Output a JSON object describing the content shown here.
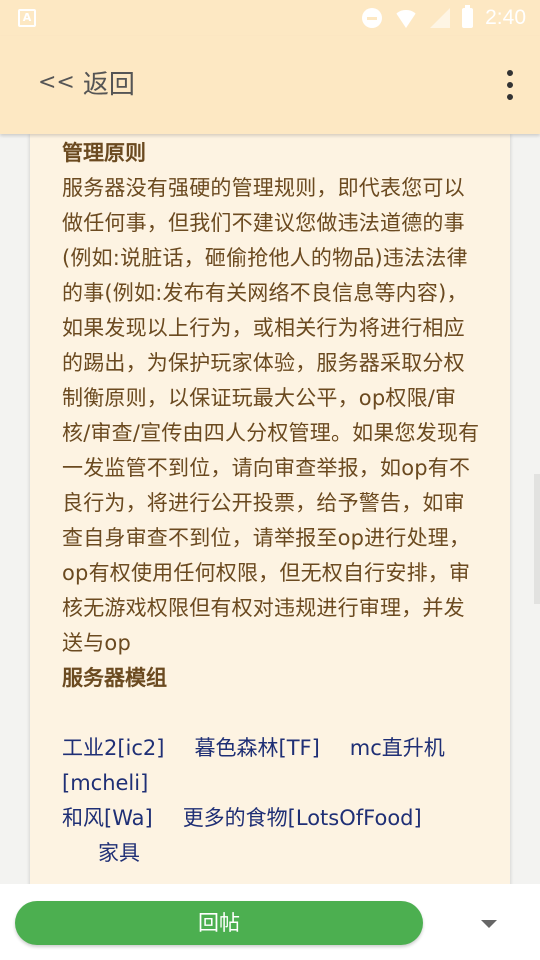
{
  "status_bar": {
    "time": "2:40",
    "left_icon_glyph": "A",
    "icons": [
      "dnd-icon",
      "wifi-icon",
      "signal-icon",
      "battery-icon"
    ]
  },
  "app_bar": {
    "back_chevron": "<<",
    "back_label": "返回",
    "menu_icon": "more-vert-icon"
  },
  "post": {
    "section1_title": "管理原则",
    "section1_body": "服务器没有强硬的管理规则，即代表您可以做任何事，但我们不建议您做违法道德的事(例如:说脏话，砸偷抢他人的物品)违法法律的事(例如:发布有关网络不良信息等内容)，如果发现以上行为，或相关行为将进行相应的踢出，为保护玩家体验，服务器采取分权制衡原则，以保证玩最大公平，op权限/审核/审查/宣传由四人分权管理。如果您发现有一发监管不到位，请向审查举报，如op有不良行为，将进行公开投票，给予警告，如审查自身审查不到位，请举报至op进行处理，op有权使用任何权限，但无权自行安排，审核无游戏权限但有权对违规进行审理，并发送与op",
    "section2_title": "服务器模组",
    "mods_row1": [
      "工业2[ic2]",
      "暮色森林[TF]",
      "mc直升机[mcheli]"
    ],
    "mods_row2": [
      "和风[Wa]",
      "更多的食物[LotsOfFood]"
    ],
    "mods_row3_partial": "家具"
  },
  "bottom_bar": {
    "reply_label": "回帖",
    "dropdown_icon": "triangle-down-icon"
  },
  "colors": {
    "header_bg": "#fde8c3",
    "card_bg": "#fdf3e2",
    "body_text": "#6b4a20",
    "mod_text": "#1f2f75",
    "reply_button": "#4caf50"
  }
}
